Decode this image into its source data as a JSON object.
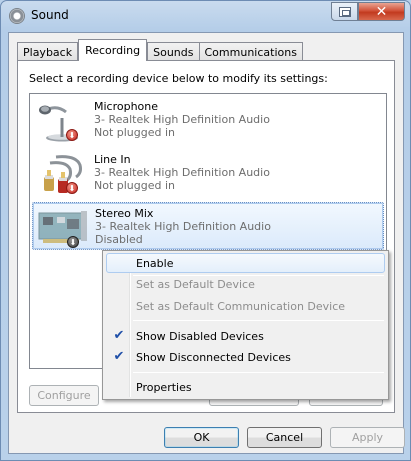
{
  "window": {
    "title": "Sound",
    "close_label": "✕"
  },
  "tabs": [
    {
      "label": "Playback",
      "active": false
    },
    {
      "label": "Recording",
      "active": true
    },
    {
      "label": "Sounds",
      "active": false
    },
    {
      "label": "Communications",
      "active": false
    }
  ],
  "instruction": "Select a recording device below to modify its settings:",
  "devices": [
    {
      "name": "Microphone",
      "driver": "3- Realtek High Definition Audio",
      "status": "Not plugged in",
      "icon": "microphone-icon",
      "badge": "red-down-arrow"
    },
    {
      "name": "Line In",
      "driver": "3- Realtek High Definition Audio",
      "status": "Not plugged in",
      "icon": "line-in-cable-icon",
      "badge": "red-down-arrow"
    },
    {
      "name": "Stereo Mix",
      "driver": "3- Realtek High Definition Audio",
      "status": "Disabled",
      "icon": "sound-card-icon",
      "badge": "dark-down-arrow",
      "selected": true
    }
  ],
  "buttons": {
    "configure": "Configure",
    "ok": "OK",
    "cancel": "Cancel",
    "apply": "Apply"
  },
  "context_menu": {
    "items": [
      {
        "label": "Enable",
        "enabled": true,
        "checked": false,
        "hover": true
      },
      {
        "label": "Set as Default Device",
        "enabled": false,
        "checked": false
      },
      {
        "label": "Set as Default Communication Device",
        "enabled": false,
        "checked": false
      },
      {
        "label": "Show Disabled Devices",
        "enabled": true,
        "checked": true
      },
      {
        "label": "Show Disconnected Devices",
        "enabled": true,
        "checked": true
      },
      {
        "label": "Properties",
        "enabled": true,
        "checked": false
      }
    ],
    "check_glyph": "✔"
  },
  "colors": {
    "accent": "#3c7fb1",
    "disabled_text": "#8d8d8d",
    "status_text": "#6d6d6d",
    "close_red": "#c23a1f"
  }
}
